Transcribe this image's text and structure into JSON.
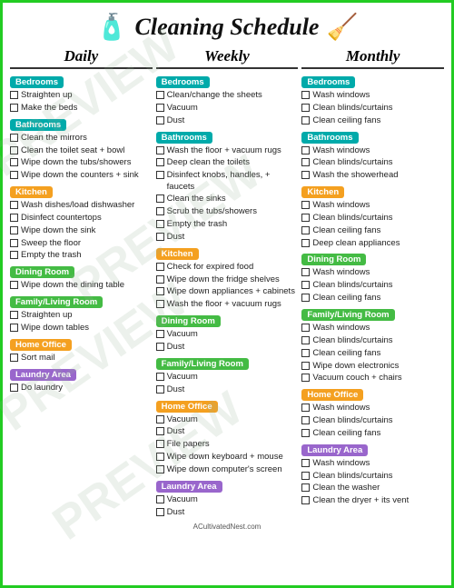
{
  "header": {
    "title": "Cleaning Schedule",
    "watermark_text": "PREVIEW"
  },
  "columns": [
    {
      "label": "Daily",
      "sections": [
        {
          "name": "Bedrooms",
          "color": "teal",
          "items": [
            "Straighten up",
            "Make the beds"
          ]
        },
        {
          "name": "Bathrooms",
          "color": "teal",
          "items": [
            "Clean the mirrors",
            "Clean the toilet seat + bowl",
            "Wipe down the tubs/showers",
            "Wipe down the counters + sink"
          ]
        },
        {
          "name": "Kitchen",
          "color": "orange",
          "items": [
            "Wash dishes/load dishwasher",
            "Disinfect countertops",
            "Wipe down the sink",
            "Sweep the floor",
            "Empty the trash"
          ]
        },
        {
          "name": "Dining Room",
          "color": "green",
          "items": [
            "Wipe down the dining table"
          ]
        },
        {
          "name": "Family/Living Room",
          "color": "green",
          "items": [
            "Straighten up",
            "Wipe down tables"
          ]
        },
        {
          "name": "Home Office",
          "color": "orange",
          "items": [
            "Sort mail"
          ]
        },
        {
          "name": "Laundry Area",
          "color": "purple",
          "items": [
            "Do laundry"
          ]
        }
      ]
    },
    {
      "label": "Weekly",
      "sections": [
        {
          "name": "Bedrooms",
          "color": "teal",
          "items": [
            "Clean/change the sheets",
            "Vacuum",
            "Dust"
          ]
        },
        {
          "name": "Bathrooms",
          "color": "teal",
          "items": [
            "Wash the floor + vacuum rugs",
            "Deep clean the toilets",
            "Disinfect knobs, handles, + faucets",
            "Clean the sinks",
            "Scrub the tubs/showers",
            "Empty the trash",
            "Dust"
          ]
        },
        {
          "name": "Kitchen",
          "color": "orange",
          "items": [
            "Check for expired food",
            "Wipe down the fridge shelves",
            "Wipe down appliances + cabinets",
            "Wash the floor + vacuum rugs"
          ]
        },
        {
          "name": "Dining Room",
          "color": "green",
          "items": [
            "Vacuum",
            "Dust"
          ]
        },
        {
          "name": "Family/Living Room",
          "color": "green",
          "items": [
            "Vacuum",
            "Dust"
          ]
        },
        {
          "name": "Home Office",
          "color": "orange",
          "items": [
            "Vacuum",
            "Dust",
            "File papers",
            "Wipe down keyboard + mouse",
            "Wipe down computer's screen"
          ]
        },
        {
          "name": "Laundry Area",
          "color": "purple",
          "items": [
            "Vacuum",
            "Dust"
          ]
        }
      ]
    },
    {
      "label": "Monthly",
      "sections": [
        {
          "name": "Bedrooms",
          "color": "teal",
          "items": [
            "Wash windows",
            "Clean blinds/curtains",
            "Clean ceiling fans"
          ]
        },
        {
          "name": "Bathrooms",
          "color": "teal",
          "items": [
            "Wash windows",
            "Clean blinds/curtains",
            "Wash the showerhead"
          ]
        },
        {
          "name": "Kitchen",
          "color": "orange",
          "items": [
            "Wash windows",
            "Clean blinds/curtains",
            "Clean ceiling fans",
            "Deep clean appliances"
          ]
        },
        {
          "name": "Dining Room",
          "color": "green",
          "items": [
            "Wash windows",
            "Clean blinds/curtains",
            "Clean ceiling fans"
          ]
        },
        {
          "name": "Family/Living Room",
          "color": "green",
          "items": [
            "Wash windows",
            "Clean blinds/curtains",
            "Clean ceiling fans",
            "Wipe down electronics",
            "Vacuum couch + chairs"
          ]
        },
        {
          "name": "Home Office",
          "color": "orange",
          "items": [
            "Wash windows",
            "Clean blinds/curtains",
            "Clean ceiling fans"
          ]
        },
        {
          "name": "Laundry Area",
          "color": "purple",
          "items": [
            "Wash windows",
            "Clean blinds/curtains",
            "Clean the washer",
            "Clean the dryer + its vent"
          ]
        }
      ]
    }
  ],
  "footer": {
    "text": "ACultivatedNest.com"
  },
  "colors": {
    "teal": "#00aaaa",
    "orange": "#f4a020",
    "green": "#44bb44",
    "purple": "#9966cc",
    "border": "#22cc22"
  }
}
